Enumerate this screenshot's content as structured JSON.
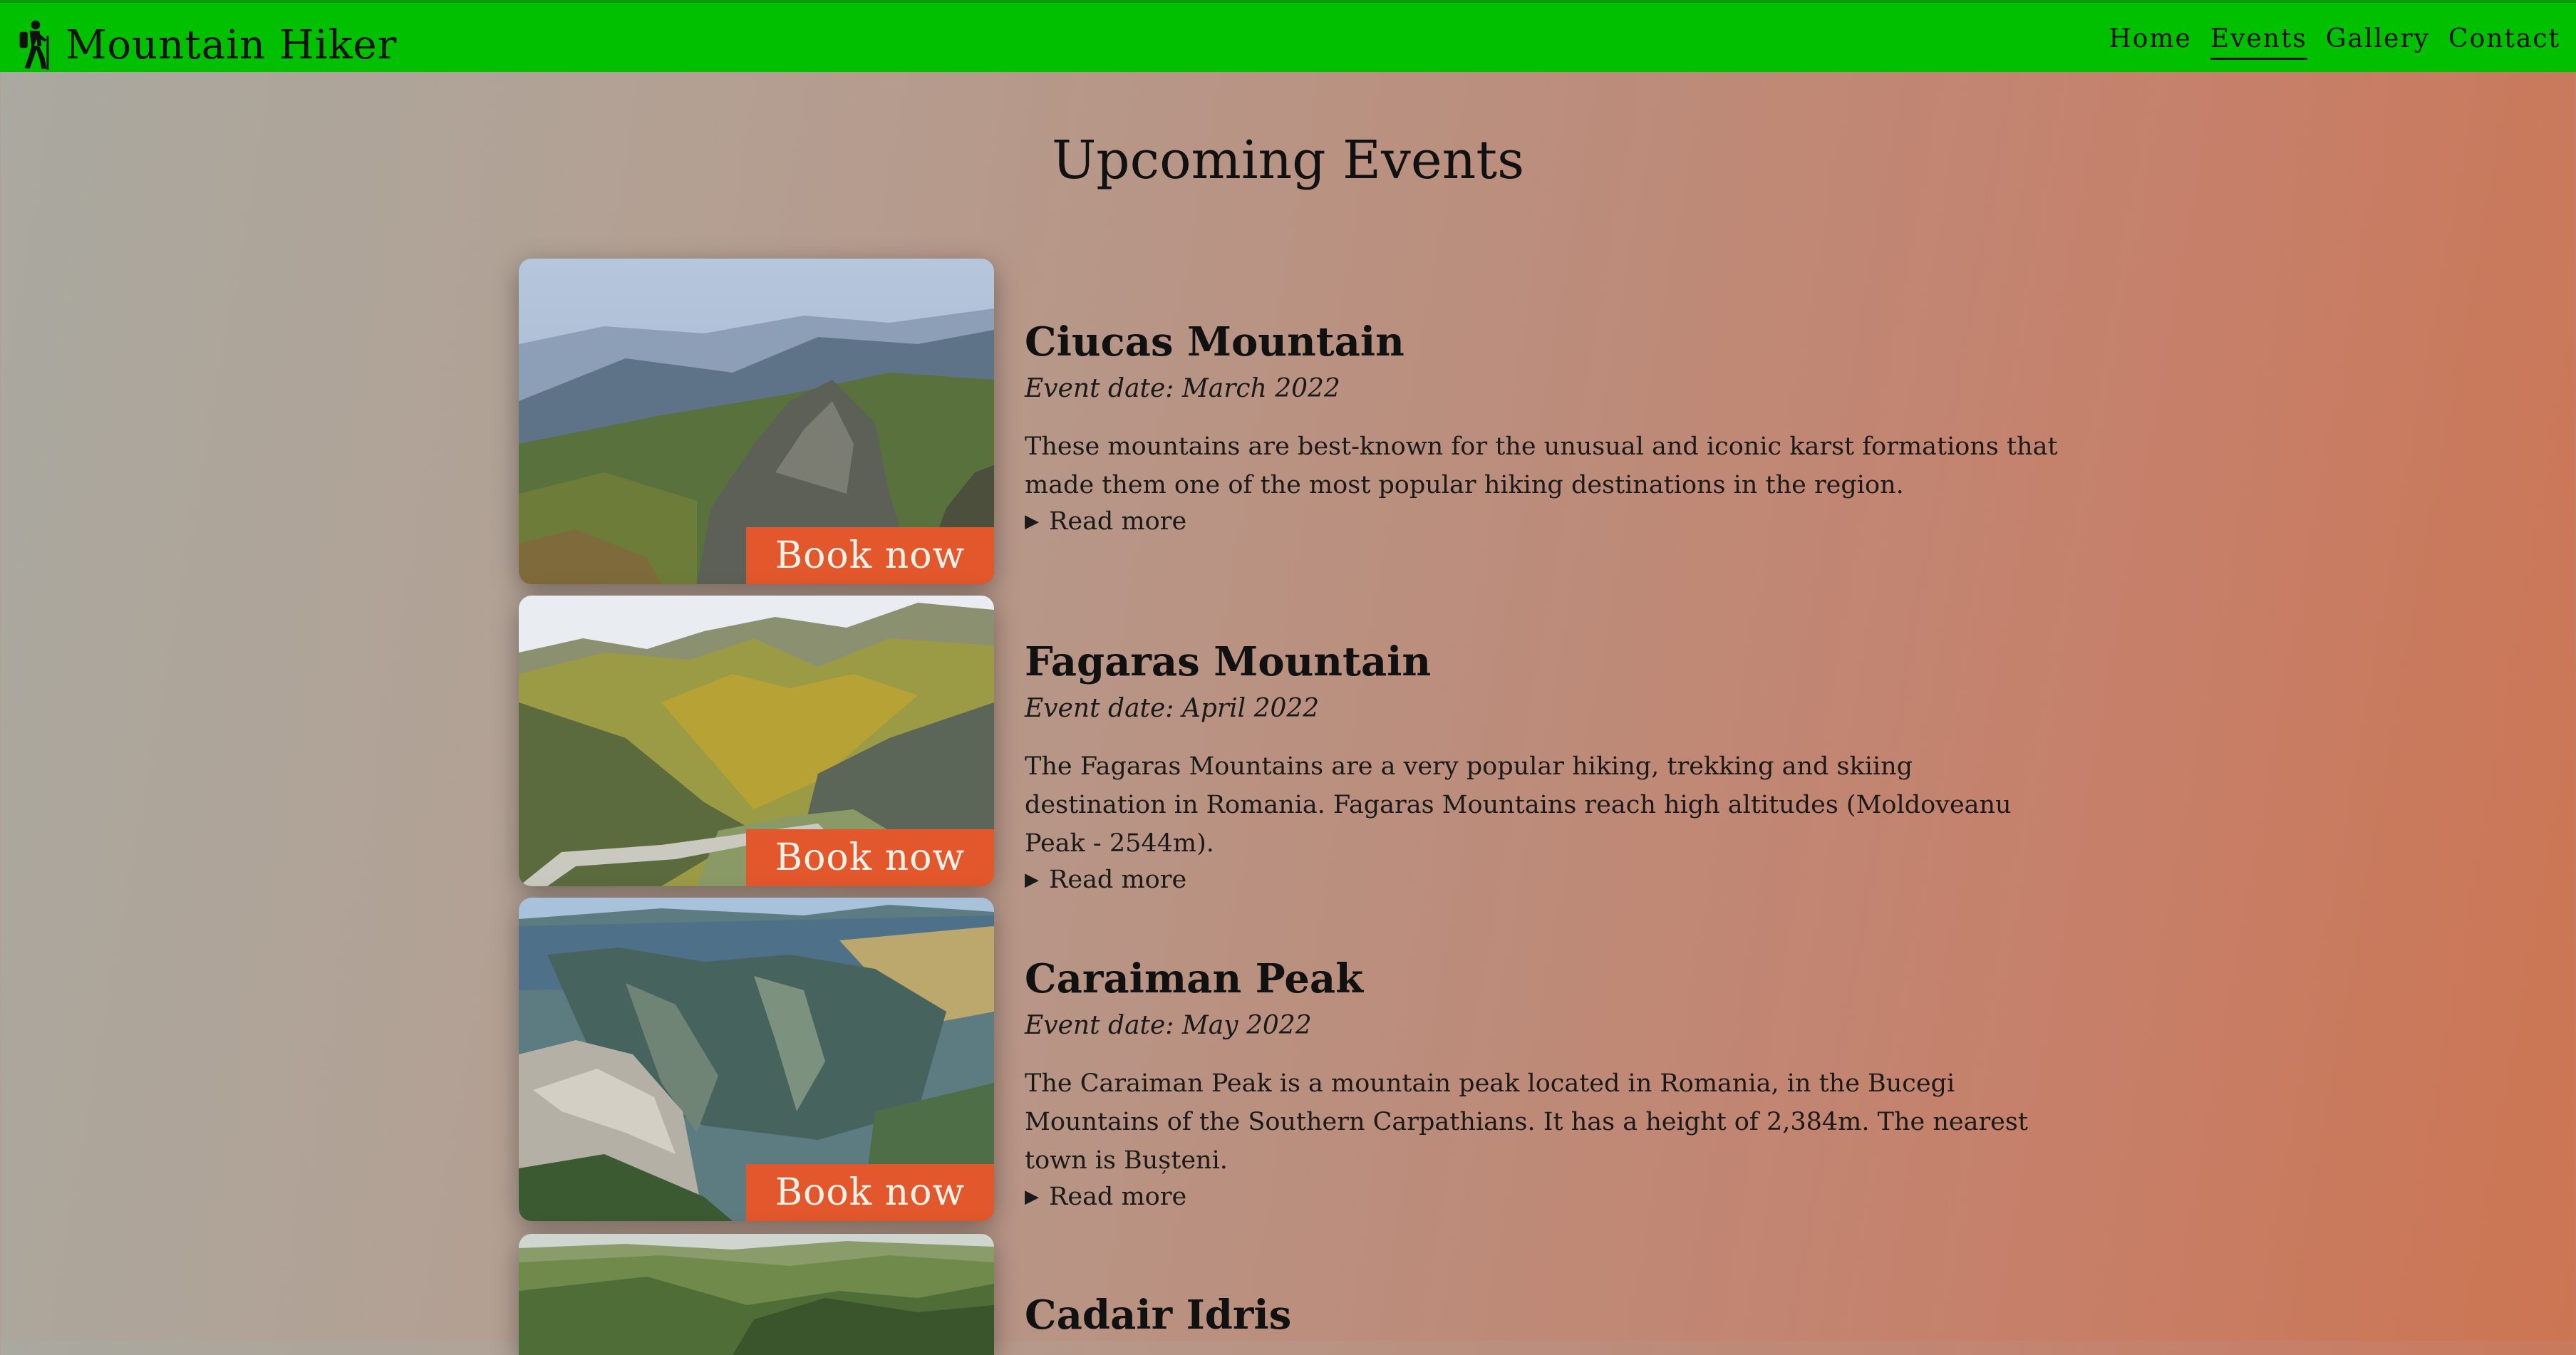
{
  "navbar": {
    "brand": "Mountain Hiker",
    "brand_icon": "hiker-icon",
    "links": [
      {
        "label": "Home",
        "active": false
      },
      {
        "label": "Events",
        "active": true
      },
      {
        "label": "Gallery",
        "active": false
      },
      {
        "label": "Contact",
        "active": false
      }
    ],
    "color": "#00c000"
  },
  "page_title": "Upcoming Events",
  "book_label": "Book now",
  "read_more_label": "Read more",
  "events": [
    {
      "title": "Ciucas Mountain",
      "date": "Event date: March 2022",
      "description": "These mountains are best-known for the unusual and iconic karst formations that made them one of the most popular hiking destinations in the region."
    },
    {
      "title": "Fagaras Mountain",
      "date": "Event date: April 2022",
      "description": "The Fagaras Mountains are a very popular hiking, trekking and skiing destination in Romania. Fagaras Mountains reach high altitudes (Moldoveanu Peak - 2544m)."
    },
    {
      "title": "Caraiman Peak",
      "date": "Event date: May 2022",
      "description": "The Caraiman Peak is a mountain peak located in Romania, in the Bucegi Mountains of the Southern Carpathians. It has a height of 2,384m. The nearest town is Bușteni."
    },
    {
      "title": "Cadair Idris"
    }
  ],
  "colors": {
    "button": "#e2572c",
    "navbar": "#00c000"
  }
}
